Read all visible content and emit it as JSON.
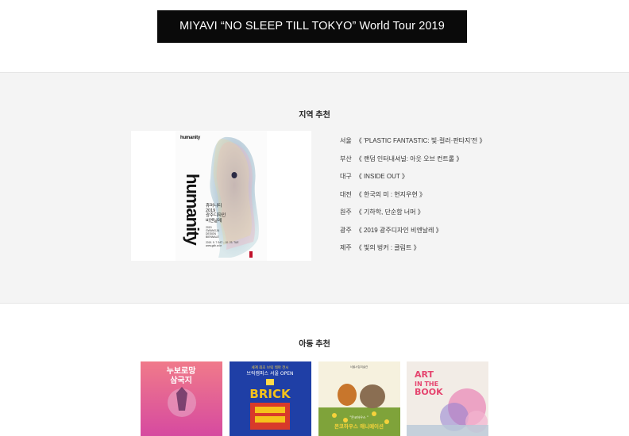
{
  "banner": {
    "title": "MIYAVI “NO SLEEP TILL TOKYO” World Tour 2019"
  },
  "region": {
    "title": "지역 추천",
    "poster": {
      "logo": "humanity",
      "vertical_text": "humanity",
      "ko_line1": "휴머니티",
      "ko_line2": "2019",
      "ko_line3": "광주디자인",
      "ko_line4": "비엔날레",
      "en_line1": "2019",
      "en_line2": "GWANGJU",
      "en_line3": "DESIGN",
      "en_line4": "BIENNALE",
      "date": "2019. 9. 7 SAT – 10. 23. TUE",
      "url": "www.gdb.or.kr"
    },
    "items": [
      {
        "city": "서울",
        "title": "《 'PLASTIC FANTASTIC: 빛·컬러·판타지'전 》"
      },
      {
        "city": "부산",
        "title": "《 랜덤 인터내셔널: 아웃 오브 컨트롤 》"
      },
      {
        "city": "대구",
        "title": "《 INSIDE OUT 》"
      },
      {
        "city": "대전",
        "title": "《 한국의 미 : 현지우현 》"
      },
      {
        "city": "원주",
        "title": "《 기하학, 단순함 너머 》"
      },
      {
        "city": "광주",
        "title": "《 2019 광주디자인 비엔날레 》"
      },
      {
        "city": "제주",
        "title": "《 빛의 벙커 : 클림트 》"
      }
    ]
  },
  "kids": {
    "title": "아동 추천",
    "thumbs": [
      {
        "line1": "누보로망",
        "line2": "삼국지"
      },
      {
        "top": "세계 최초 브릭 테마 전시",
        "line1": "브릭캠퍼스 서울 OPEN",
        "big": "BRICK"
      },
      {
        "top": "서울시립미술관",
        "line1": "몬코하우스 애니메이션",
        "quote": "\"몬코하우스 \" "
      },
      {
        "line1": "ART",
        "line2": "IN THE",
        "line3": "BOOK"
      }
    ]
  },
  "colors": {
    "banner_bg": "#0a0a0a",
    "section_bg": "#f4f4f4"
  }
}
